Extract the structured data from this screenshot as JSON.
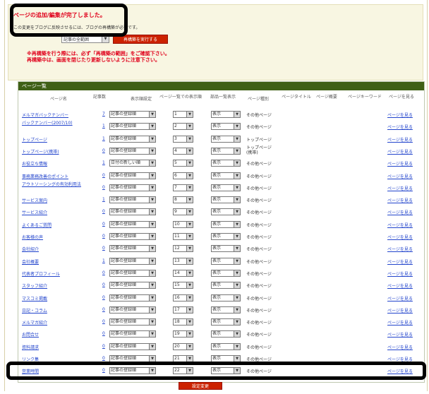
{
  "notice": {
    "done": "ページの追加/編集が完了しました。",
    "sub": "この変更をブログに反映させるには、ブログの再構築が必要です。",
    "range_select": "記事の全範囲",
    "rebuild_button": "再構築を実行する",
    "warn1": "※再構築を行う際には、必ず「再構築の範囲」をご確認下さい。",
    "warn2": "再構築中は、画面を閉じたり更新しないように注意下さい。"
  },
  "list": {
    "title": "ページ一覧",
    "headers": {
      "name": "ページ名",
      "count": "記事数",
      "order": "表示順設定",
      "pos": "ページ一覧での表示順",
      "show": "部品一覧表示",
      "type": "ページ種別",
      "ptitle": "ページタイトル",
      "pdesc": "ページ概要",
      "keyword": "ページキーワード",
      "view": "ページを見る"
    },
    "rows": [
      {
        "name": "メルマガバックナンバー",
        "count": "7",
        "order": "記事の登録順",
        "pos": "1",
        "show": "表示",
        "type": "その他ページ",
        "view": "ページを見る"
      },
      {
        "name": "バックナンバー(2007/10)",
        "count": "1",
        "order": "記事の登録順",
        "pos": "2",
        "show": "表示",
        "type": "その他ページ",
        "view": "ページを見る"
      },
      {
        "name": "トップページ",
        "count": "1",
        "order": "記事の登録順",
        "pos": "3",
        "show": "表示",
        "type": "トップページ",
        "view": "ページを見る"
      },
      {
        "name": "トップページ(携帯)",
        "count": "0",
        "order": "記事の登録順",
        "pos": "4",
        "show": "表示",
        "type": "トップページ(携帯)",
        "view": "ページを見る"
      },
      {
        "name": "お役立ち情報",
        "count": "1",
        "order": "日付の新しい順",
        "pos": "5",
        "show": "表示",
        "type": "その他ページ",
        "view": "ページを見る"
      },
      {
        "name": "事務業務改善のポイント",
        "count": "0",
        "order": "記事の登録順",
        "pos": "6",
        "show": "表示",
        "type": "その他ページ",
        "view": "ページを見る"
      },
      {
        "name": "アウトソーシングの有効利用法",
        "count": "0",
        "order": "記事の登録順",
        "pos": "7",
        "show": "表示",
        "type": "その他ページ",
        "view": "ページを見る"
      },
      {
        "name": "サービス案内",
        "count": "1",
        "order": "記事の登録順",
        "pos": "8",
        "show": "表示",
        "type": "その他ページ",
        "view": "ページを見る"
      },
      {
        "name": "サービス紹介",
        "count": "0",
        "order": "記事の登録順",
        "pos": "9",
        "show": "表示",
        "type": "その他ページ",
        "view": "ページを見る"
      },
      {
        "name": "よくあるご質問",
        "count": "0",
        "order": "記事の登録順",
        "pos": "10",
        "show": "表示",
        "type": "その他ページ",
        "view": "ページを見る"
      },
      {
        "name": "お客様の声",
        "count": "0",
        "order": "記事の登録順",
        "pos": "11",
        "show": "表示",
        "type": "その他ページ",
        "view": "ページを見る"
      },
      {
        "name": "会社紹介",
        "count": "0",
        "order": "記事の登録順",
        "pos": "12",
        "show": "表示",
        "type": "その他ページ",
        "view": "ページを見る"
      },
      {
        "name": "会社概要",
        "count": "1",
        "order": "記事の登録順",
        "pos": "13",
        "show": "表示",
        "type": "その他ページ",
        "view": "ページを見る"
      },
      {
        "name": "代表者プロフィール",
        "count": "0",
        "order": "記事の登録順",
        "pos": "14",
        "show": "表示",
        "type": "その他ページ",
        "view": "ページを見る"
      },
      {
        "name": "スタッフ紹介",
        "count": "0",
        "order": "記事の登録順",
        "pos": "15",
        "show": "表示",
        "type": "その他ページ",
        "view": "ページを見る"
      },
      {
        "name": "マスコミ掲載",
        "count": "0",
        "order": "記事の登録順",
        "pos": "16",
        "show": "表示",
        "type": "その他ページ",
        "view": "ページを見る"
      },
      {
        "name": "日記・コラム",
        "count": "0",
        "order": "記事の登録順",
        "pos": "17",
        "show": "表示",
        "type": "その他ページ",
        "view": "ページを見る"
      },
      {
        "name": "メルマガ紹介",
        "count": "0",
        "order": "記事の登録順",
        "pos": "18",
        "show": "表示",
        "type": "その他ページ",
        "view": "ページを見る"
      },
      {
        "name": "お問合せ",
        "count": "0",
        "order": "記事の登録順",
        "pos": "19",
        "show": "表示",
        "type": "その他ページ",
        "view": "ページを見る"
      },
      {
        "name": "資料請求",
        "count": "0",
        "order": "記事の登録順",
        "pos": "20",
        "show": "表示",
        "type": "その他ページ",
        "view": "ページを見る"
      },
      {
        "name": "リンク集",
        "count": "0",
        "order": "記事の登録順",
        "pos": "21",
        "show": "表示",
        "type": "その他ページ",
        "view": "ページを見る"
      },
      {
        "name": "営業時間",
        "count": "0",
        "order": "記事の登録順",
        "pos": "22",
        "show": "表示",
        "type": "その他ページ",
        "view": "ページを見る"
      }
    ],
    "submit_button": "設定変更"
  },
  "colors": {
    "accent": "#e0001b",
    "header_bar": "#3f6016",
    "link": "#2244cc"
  }
}
